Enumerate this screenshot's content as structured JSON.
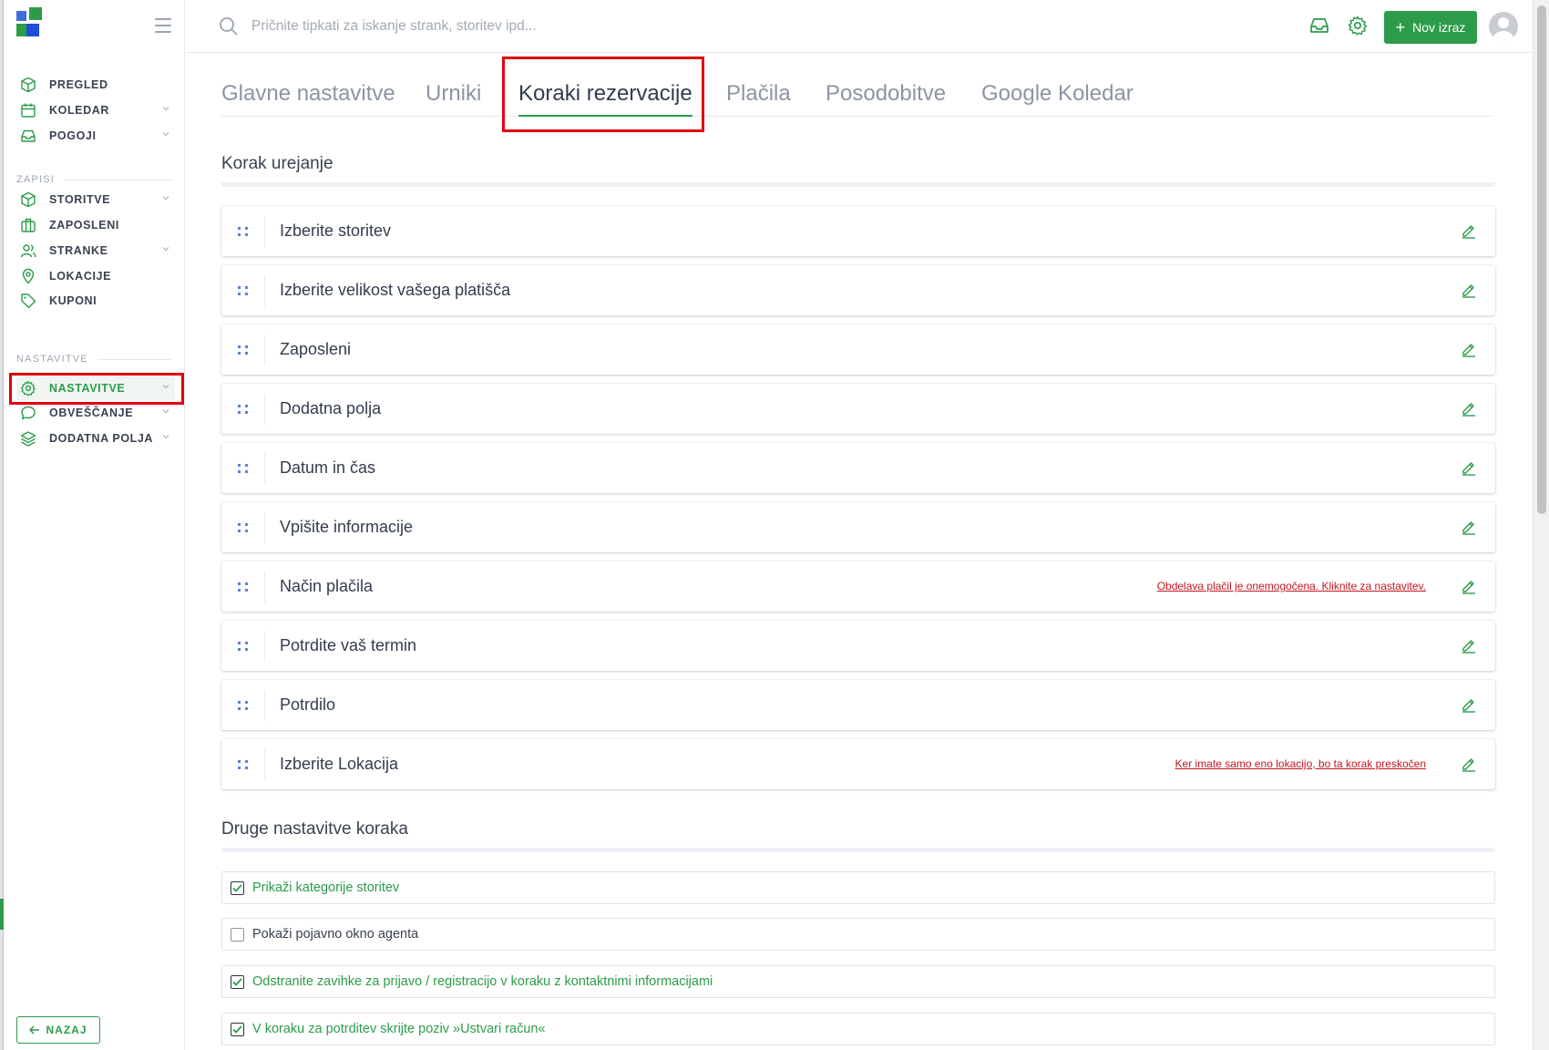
{
  "app": {
    "search_placeholder": "Pričnite tipkati za iskanje strank, storitev ipd...",
    "new_button_label": "Nov izraz",
    "colors": {
      "accent": "#2c9c4a",
      "warning": "#c4141e",
      "highlight_box": "#e3000f"
    }
  },
  "sidebar": {
    "main_items": [
      {
        "label": "PREGLED",
        "icon": "cube-icon",
        "has_chevron": false
      },
      {
        "label": "KOLEDAR",
        "icon": "calendar-icon",
        "has_chevron": true
      },
      {
        "label": "POGOJI",
        "icon": "inbox-icon",
        "has_chevron": true
      }
    ],
    "section_records": "ZAPISI",
    "record_items": [
      {
        "label": "STORITVE",
        "icon": "cube-icon",
        "has_chevron": true
      },
      {
        "label": "ZAPOSLENI",
        "icon": "briefcase-icon",
        "has_chevron": false
      },
      {
        "label": "STRANKE",
        "icon": "users-icon",
        "has_chevron": true
      },
      {
        "label": "LOKACIJE",
        "icon": "map-pin-icon",
        "has_chevron": false
      },
      {
        "label": "KUPONI",
        "icon": "tag-icon",
        "has_chevron": false
      }
    ],
    "section_settings": "NASTAVITVE",
    "settings_items": [
      {
        "label": "NASTAVITVE",
        "icon": "gear-icon",
        "has_chevron": true,
        "active": true
      },
      {
        "label": "OBVEŠČANJE",
        "icon": "chat-icon",
        "has_chevron": true
      },
      {
        "label": "DODATNA POLJA",
        "icon": "layers-icon",
        "has_chevron": true
      }
    ],
    "back_label": "NAZAJ"
  },
  "tabs": [
    {
      "label": "Glavne nastavitve",
      "active": false
    },
    {
      "label": "Urniki",
      "active": false
    },
    {
      "label": "Koraki rezervacije",
      "active": true
    },
    {
      "label": "Plačila",
      "active": false
    },
    {
      "label": "Posodobitve",
      "active": false
    },
    {
      "label": "Google Koledar",
      "active": false
    }
  ],
  "steps_section_title": "Korak urejanje",
  "steps": [
    {
      "title": "Izberite storitev",
      "warning": ""
    },
    {
      "title": "Izberite velikost vašega platišča",
      "warning": ""
    },
    {
      "title": "Zaposleni",
      "warning": ""
    },
    {
      "title": "Dodatna polja",
      "warning": ""
    },
    {
      "title": "Datum in čas",
      "warning": ""
    },
    {
      "title": "Vpišite informacije",
      "warning": ""
    },
    {
      "title": "Način plačila",
      "warning": "Obdelava plačil je onemogočena. Kliknite za nastavitev."
    },
    {
      "title": "Potrdite vaš termin",
      "warning": ""
    },
    {
      "title": "Potrdilo",
      "warning": ""
    },
    {
      "title": "Izberite Lokacija",
      "warning": "Ker imate samo eno lokacijo, bo ta korak preskočen"
    }
  ],
  "other_section_title": "Druge nastavitve koraka",
  "options": [
    {
      "label": "Prikaži kategorije storitev",
      "checked": true
    },
    {
      "label": "Pokaži pojavno okno agenta",
      "checked": false
    },
    {
      "label": "Odstranite zavihke za prijavo / registracijo v koraku z kontaktnimi informacijami",
      "checked": true
    },
    {
      "label": "V koraku za potrditev skrijte poziv »Ustvari račun«",
      "checked": true
    }
  ]
}
